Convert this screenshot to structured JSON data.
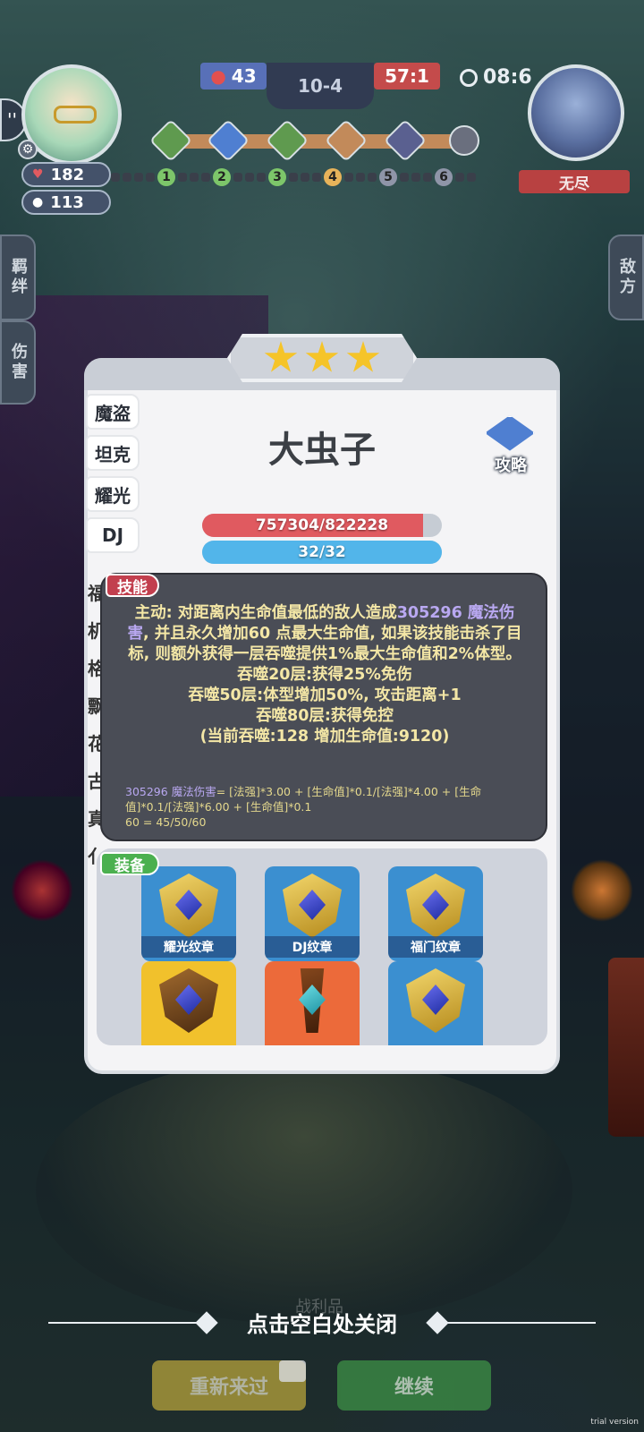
{
  "hud": {
    "score_left": "43",
    "stage": "10-4",
    "score_right": "57:1",
    "timer": "08:6",
    "player_hp": "182",
    "player_coins": "113",
    "enemy_label": "无尽",
    "wave_numbers": [
      "1",
      "2",
      "3",
      "4",
      "5",
      "6"
    ]
  },
  "side_tabs": {
    "bond": "羁绊",
    "damage": "伤害",
    "enemy": "敌方"
  },
  "unit": {
    "stars": 3,
    "name": "大虫子",
    "traits": [
      "魔盗",
      "坦克",
      "耀光",
      "DJ"
    ],
    "hidden_traits": [
      "福",
      "机",
      "格",
      "飘",
      "花",
      "古",
      "真",
      "亻"
    ],
    "hp_text": "757304/822228",
    "hp_fraction": 0.92,
    "mp_text": "32/32",
    "mp_fraction": 1.0,
    "guide_label": "攻略"
  },
  "skill": {
    "tag": "技能",
    "line1_a": "主动: 对距离内生命值最低的敌人造成",
    "line1_hl": "305296 魔法伤害",
    "line1_b": ", 并且永久增加60 点最大生命值, 如果该技能击杀了目标, 则额外获得一层吞噬提供1%最大生命值和2%体型。",
    "line2": "吞噬20层:获得25%免伤",
    "line3": "吞噬50层:体型增加50%, 攻击距离+1",
    "line4": "吞噬80层:获得免控",
    "line5": "(当前吞噬:128 增加生命值:9120)",
    "formula_hl": "305296 魔法伤害",
    "formula_rest": "= [法强]*3.00 + [生命值]*0.1/[法强]*4.00 + [生命值]*0.1/[法强]*6.00 + [生命值]*0.1",
    "formula_line2": "60 = 45/50/60"
  },
  "equipment": {
    "tag": "装备",
    "items": [
      {
        "name": "耀光纹章",
        "color": "#3b8fd0"
      },
      {
        "name": "DJ纹章",
        "color": "#3b8fd0"
      },
      {
        "name": "福门纹章",
        "color": "#3b8fd0"
      },
      {
        "name": "",
        "color": "#f1c12c"
      },
      {
        "name": "",
        "color": "#ec6a3a"
      },
      {
        "name": "",
        "color": "#3b8fd0"
      }
    ]
  },
  "footer": {
    "loot_label": "战利品",
    "close_hint": "点击空白处关闭",
    "restart_label": "重新来过",
    "continue_label": "继续",
    "watermark": "trial version"
  }
}
